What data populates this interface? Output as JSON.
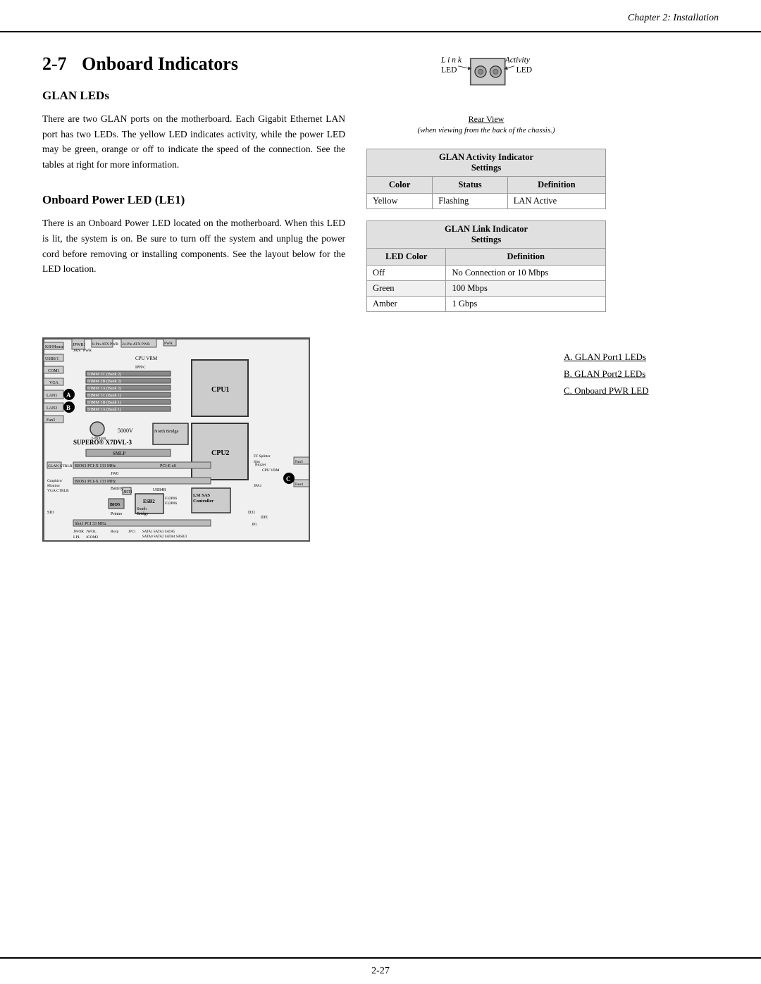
{
  "header": {
    "title": "Chapter 2: Installation"
  },
  "chapter_section": {
    "number": "2-7",
    "title": "Onboard Indicators"
  },
  "glan_leds": {
    "heading": "GLAN LEDs",
    "body": "There are two GLAN ports on the motherboard. Each Gigabit Ethernet LAN port has two LEDs. The yellow LED indicates activity, while the power LED may be green, orange or off to indicate the speed of the connection. See the tables at right for more information."
  },
  "onboard_power": {
    "heading": "Onboard Power LED (LE1)",
    "body": "There is an Onboard Power LED located on the motherboard. When this LED is lit, the system is on. Be sure to turn off the system and unplug the power cord before removing or installing components. See the layout below for the LED location."
  },
  "led_diagram": {
    "link_label": "L i n k",
    "activity_label": "Activity",
    "led_left": "LED",
    "led_right": "LED",
    "rear_view": "Rear View",
    "rear_view_sub": "(when viewing from the back of the chassis.)"
  },
  "activity_table": {
    "title": "GLAN Activity Indicator",
    "subtitle": "Settings",
    "columns": [
      "Color",
      "Status",
      "Definition"
    ],
    "rows": [
      [
        "Yellow",
        "Flashing",
        "LAN Active"
      ]
    ]
  },
  "link_table": {
    "title": "GLAN  Link  Indicator",
    "subtitle": "Settings",
    "columns": [
      "LED Color",
      "Definition"
    ],
    "rows": [
      [
        "Off",
        "No Connection or 10 Mbps"
      ],
      [
        "Green",
        "100 Mbps"
      ],
      [
        "Amber",
        "1 Gbps"
      ]
    ]
  },
  "legend": {
    "items": [
      "A. GLAN Port1 LEDs",
      "B. GLAN Port2 LEDs",
      "C. Onboard PWR LED"
    ]
  },
  "footer": {
    "page": "2-27"
  },
  "motherboard": {
    "model": "SUPERO® X7DVL-3",
    "voltage": "5000V",
    "components": {
      "cpu1": "CPU1",
      "cpu2": "CPU2",
      "north_bridge": "North Bridge",
      "esb2": "ESB2",
      "south_bridge": "South Bridge",
      "smlp": "SMLP",
      "lsi_sas": "LSI SAS\nController",
      "i_button": "I-Button"
    },
    "dimms": [
      "DIMM 2C (Bank 2)",
      "DIMM 2B (Bank 2)",
      "DIMM 2A (Bank 2)",
      "DIMM 1C (Bank 1)",
      "DIMM 1B (Bank 1)",
      "DIMM 1A (Bank 1)"
    ],
    "labels_left": [
      "KB/Mouse",
      "USB0/1",
      "COM1",
      "VGA",
      "LAN1",
      "LAN2",
      "Fan3"
    ],
    "labels_right": [
      "Fan5",
      "Fan4"
    ],
    "slots": [
      "BIOS1 PCI-X 133 MHz",
      "BIOS1 PCI-X 133 MHz",
      "Slot1 PCI 33 MHz"
    ]
  }
}
